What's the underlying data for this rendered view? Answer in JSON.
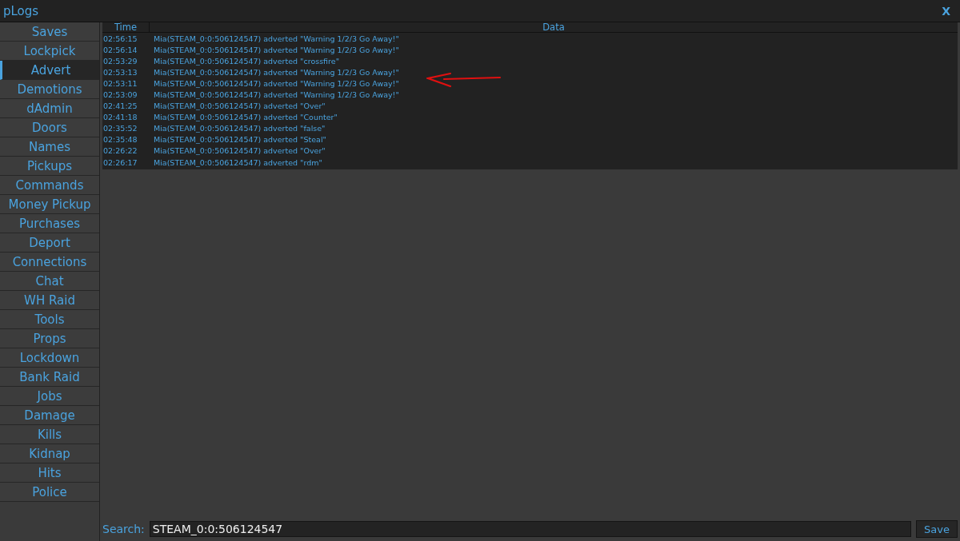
{
  "window": {
    "title": "pLogs",
    "close": "X"
  },
  "sidebar": {
    "items": [
      {
        "label": "Saves",
        "selected": false
      },
      {
        "label": "Lockpick",
        "selected": false
      },
      {
        "label": "Advert",
        "selected": true
      },
      {
        "label": "Demotions",
        "selected": false
      },
      {
        "label": "dAdmin",
        "selected": false
      },
      {
        "label": "Doors",
        "selected": false
      },
      {
        "label": "Names",
        "selected": false
      },
      {
        "label": "Pickups",
        "selected": false
      },
      {
        "label": "Commands",
        "selected": false
      },
      {
        "label": "Money Pickup",
        "selected": false
      },
      {
        "label": "Purchases",
        "selected": false
      },
      {
        "label": "Deport",
        "selected": false
      },
      {
        "label": "Connections",
        "selected": false
      },
      {
        "label": "Chat",
        "selected": false
      },
      {
        "label": "WH Raid",
        "selected": false
      },
      {
        "label": "Tools",
        "selected": false
      },
      {
        "label": "Props",
        "selected": false
      },
      {
        "label": "Lockdown",
        "selected": false
      },
      {
        "label": "Bank Raid",
        "selected": false
      },
      {
        "label": "Jobs",
        "selected": false
      },
      {
        "label": "Damage",
        "selected": false
      },
      {
        "label": "Kills",
        "selected": false
      },
      {
        "label": "Kidnap",
        "selected": false
      },
      {
        "label": "Hits",
        "selected": false
      },
      {
        "label": "Police",
        "selected": false
      }
    ]
  },
  "table": {
    "columns": [
      "Time",
      "Data"
    ],
    "rows": [
      [
        "02:56:15",
        "Mia(STEAM_0:0:506124547) adverted \"Warning 1/2/3 Go Away!\""
      ],
      [
        "02:56:14",
        "Mia(STEAM_0:0:506124547) adverted \"Warning 1/2/3 Go Away!\""
      ],
      [
        "02:53:29",
        "Mia(STEAM_0:0:506124547) adverted \"crossfire\""
      ],
      [
        "02:53:13",
        "Mia(STEAM_0:0:506124547) adverted \"Warning 1/2/3 Go Away!\""
      ],
      [
        "02:53:11",
        "Mia(STEAM_0:0:506124547) adverted \"Warning 1/2/3 Go Away!\""
      ],
      [
        "02:53:09",
        "Mia(STEAM_0:0:506124547) adverted \"Warning 1/2/3 Go Away!\""
      ],
      [
        "02:41:25",
        "Mia(STEAM_0:0:506124547) adverted \"Over\""
      ],
      [
        "02:41:18",
        "Mia(STEAM_0:0:506124547) adverted \"Counter\""
      ],
      [
        "02:35:52",
        "Mia(STEAM_0:0:506124547) adverted \"false\""
      ],
      [
        "02:35:48",
        "Mia(STEAM_0:0:506124547) adverted \"Steal\""
      ],
      [
        "02:26:22",
        "Mia(STEAM_0:0:506124547) adverted \"Over\""
      ],
      [
        "02:26:17",
        "Mia(STEAM_0:0:506124547) adverted \"rdm\""
      ]
    ]
  },
  "search": {
    "label": "Search:",
    "value": "STEAM_0:0:506124547"
  },
  "save_button": "Save"
}
